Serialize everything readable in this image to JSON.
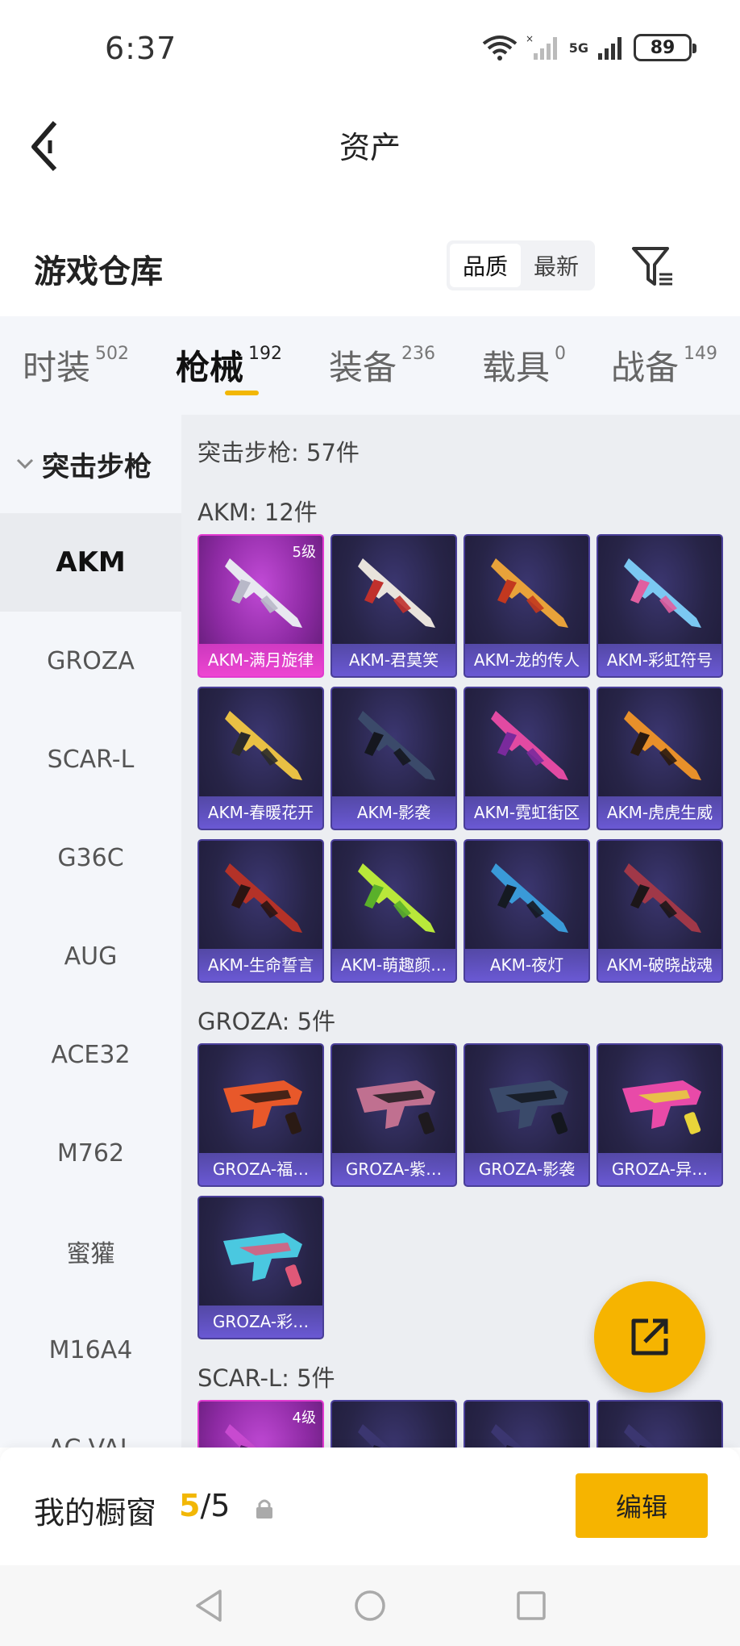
{
  "status_bar": {
    "time": "6:37",
    "battery": "89",
    "network": "5G"
  },
  "header": {
    "title": "资产"
  },
  "warehouse": {
    "title": "游戏仓库",
    "sort_options": [
      "品质",
      "最新"
    ],
    "sort_active": "品质"
  },
  "tabs": [
    {
      "label": "时装",
      "count": "502"
    },
    {
      "label": "枪械",
      "count": "192",
      "active": true
    },
    {
      "label": "装备",
      "count": "236"
    },
    {
      "label": "载具",
      "count": "0"
    },
    {
      "label": "战备",
      "count": "149"
    }
  ],
  "sidebar": {
    "group": "突击步枪",
    "items": [
      "AKM",
      "GROZA",
      "SCAR-L",
      "G36C",
      "AUG",
      "ACE32",
      "M762",
      "蜜獾",
      "M16A4",
      "AC-VAL"
    ],
    "active": "AKM"
  },
  "main": {
    "category_total": "突击步枪: 57件",
    "sections": [
      {
        "title": "AKM: 12件",
        "items": [
          {
            "name": "AKM-满月旋律",
            "level": "5级",
            "highlight": true,
            "colors": [
              "#e8e8f0",
              "#b8b8c8"
            ]
          },
          {
            "name": "AKM-君莫笑",
            "colors": [
              "#e9e3dc",
              "#c0302c"
            ]
          },
          {
            "name": "AKM-龙的传人",
            "colors": [
              "#e8a23a",
              "#c2381f"
            ]
          },
          {
            "name": "AKM-彩虹符号",
            "colors": [
              "#7bc8f2",
              "#e05fa0"
            ]
          },
          {
            "name": "AKM-春暖花开",
            "colors": [
              "#e9c044",
              "#2a2a2a"
            ]
          },
          {
            "name": "AKM-影袭",
            "colors": [
              "#3b4a6a",
              "#15171f"
            ]
          },
          {
            "name": "AKM-霓虹街区",
            "colors": [
              "#e14aa2",
              "#7a2a9c"
            ]
          },
          {
            "name": "AKM-虎虎生威",
            "colors": [
              "#e8902a",
              "#2a1a10"
            ]
          },
          {
            "name": "AKM-生命誓言",
            "colors": [
              "#b43228",
              "#2a1412"
            ]
          },
          {
            "name": "AKM-萌趣颜…",
            "colors": [
              "#b9e83a",
              "#5ab02a"
            ]
          },
          {
            "name": "AKM-夜灯",
            "colors": [
              "#3a9ad8",
              "#151a22"
            ]
          },
          {
            "name": "AKM-破晓战魂",
            "colors": [
              "#a03848",
              "#1c1618"
            ]
          }
        ]
      },
      {
        "title": "GROZA: 5件",
        "items": [
          {
            "name": "GROZA-福…",
            "colors": [
              "#e8582a",
              "#2a1a14"
            ]
          },
          {
            "name": "GROZA-紫…",
            "colors": [
              "#c07090",
              "#1e1a1e"
            ]
          },
          {
            "name": "GROZA-影袭",
            "colors": [
              "#3a4a6a",
              "#14171e"
            ]
          },
          {
            "name": "GROZA-异…",
            "colors": [
              "#e84aa8",
              "#e8d43a"
            ]
          },
          {
            "name": "GROZA-彩…",
            "colors": [
              "#4ac8e0",
              "#e05878"
            ]
          }
        ]
      },
      {
        "title": "SCAR-L: 5件",
        "items": [
          {
            "name": "",
            "level": "4级",
            "highlight": true,
            "colors": [
              "#c84ad0",
              "#5a1a6e"
            ]
          },
          {
            "name": "",
            "colors": [
              "#3b3670",
              "#1e1b38"
            ]
          },
          {
            "name": "",
            "colors": [
              "#3b3670",
              "#1e1b38"
            ]
          },
          {
            "name": "",
            "colors": [
              "#3b3670",
              "#1e1b38"
            ]
          }
        ]
      }
    ]
  },
  "showcase": {
    "label": "我的橱窗",
    "current": "5",
    "total": "/5",
    "edit_label": "编辑"
  },
  "accent": "#f6b400",
  "icons": [
    "back-arrow-icon",
    "filter-icon",
    "wifi-icon",
    "signal-icon",
    "battery-icon",
    "share-edit-icon",
    "lock-icon",
    "nav-back-icon",
    "nav-home-icon",
    "nav-recent-icon"
  ]
}
